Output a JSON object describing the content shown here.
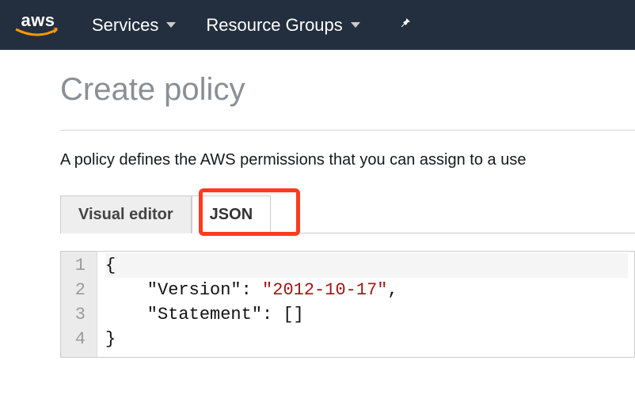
{
  "nav": {
    "logo_text": "aws",
    "services": "Services",
    "resource_groups": "Resource Groups"
  },
  "page": {
    "title": "Create policy",
    "description": "A policy defines the AWS permissions that you can assign to a use"
  },
  "tabs": {
    "visual_editor": "Visual editor",
    "json": "JSON"
  },
  "editor": {
    "lines": [
      "1",
      "2",
      "3",
      "4"
    ],
    "code": {
      "l1": "{",
      "l2a": "    \"Version\": ",
      "l2b": "\"2012-10-17\"",
      "l2c": ",",
      "l3": "    \"Statement\": []",
      "l4": "}"
    }
  }
}
